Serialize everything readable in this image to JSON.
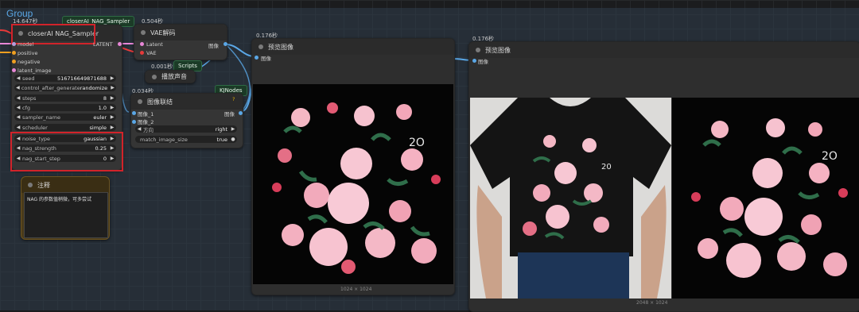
{
  "group": {
    "title": "Group"
  },
  "sampler": {
    "time": "14.647秒",
    "badge": "closerAI_NAG_Sampler",
    "title": "closerAI NAG_Sampler",
    "output": "LATENT",
    "inputs": [
      "model",
      "positive",
      "negative",
      "latent_image"
    ],
    "widgets": [
      {
        "label": "seed",
        "value": "516716649871688"
      },
      {
        "label": "control_after_generate",
        "value": "randomize"
      },
      {
        "label": "steps",
        "value": "8"
      },
      {
        "label": "cfg",
        "value": "1.0"
      },
      {
        "label": "sampler_name",
        "value": "euler"
      },
      {
        "label": "scheduler",
        "value": "simple"
      },
      {
        "label": "noise_type",
        "value": "gaussian"
      },
      {
        "label": "nag_strength",
        "value": "0.25"
      },
      {
        "label": "nag_start_step",
        "value": "0"
      }
    ]
  },
  "vae": {
    "time": "0.504秒",
    "title": "VAE解码",
    "inputs": [
      "Latent",
      "VAE"
    ],
    "output": "图像"
  },
  "scripts": {
    "time": "0.001秒",
    "badge": "Scripts",
    "title": "播放声音"
  },
  "concat": {
    "time": "0.034秒",
    "badge": "KJNodes",
    "title": "图像联结",
    "help": "?",
    "inputs": [
      "图像_1",
      "图像_2"
    ],
    "output": "图像",
    "widgets": [
      {
        "label": "方向",
        "value": "right"
      },
      {
        "label": "match_image_size",
        "value": "true"
      }
    ]
  },
  "note": {
    "title": "注释",
    "text": "NAG 的参数值稍微，可多尝试"
  },
  "preview1": {
    "time": "0.176秒",
    "title": "预览图像",
    "input": "图像",
    "caption": "1024 × 1024"
  },
  "preview2": {
    "time": "0.176秒",
    "title": "预览图像",
    "input": "图像",
    "caption": "2048 × 1024"
  },
  "colors": {
    "accent_red": "#d2232a",
    "badge_green": "#1b3b27",
    "link_pink": "#e887d7",
    "link_blue": "#5aa7e6",
    "group_blue": "#2f3e4c"
  }
}
